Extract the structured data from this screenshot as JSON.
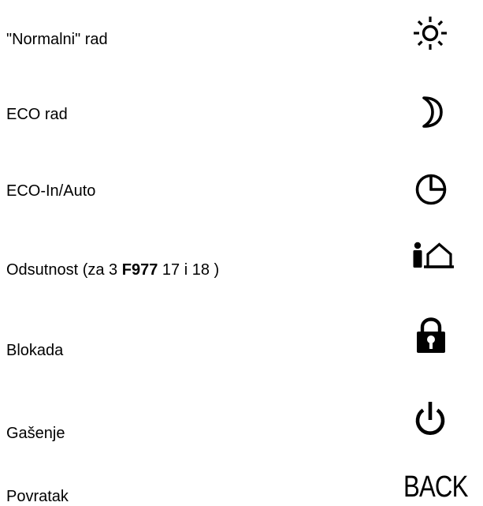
{
  "modes": [
    {
      "label": "\"Normalni\" rad",
      "icon": "sun-icon"
    },
    {
      "label": "ECO rad",
      "icon": "moon-icon"
    },
    {
      "label": "ECO-In/Auto",
      "icon": "clock-icon"
    },
    {
      "label_before": "Odsutnost (za 3 ",
      "label_bold": "F977",
      "label_after": " 17 i 18 )",
      "icon": "person-away-house-icon"
    },
    {
      "label": "Blokada",
      "icon": "padlock-icon"
    },
    {
      "label": "Gašenje",
      "icon": "power-icon"
    },
    {
      "label": "Povratak",
      "icon": "back-icon",
      "icon_text": "BACK"
    }
  ]
}
